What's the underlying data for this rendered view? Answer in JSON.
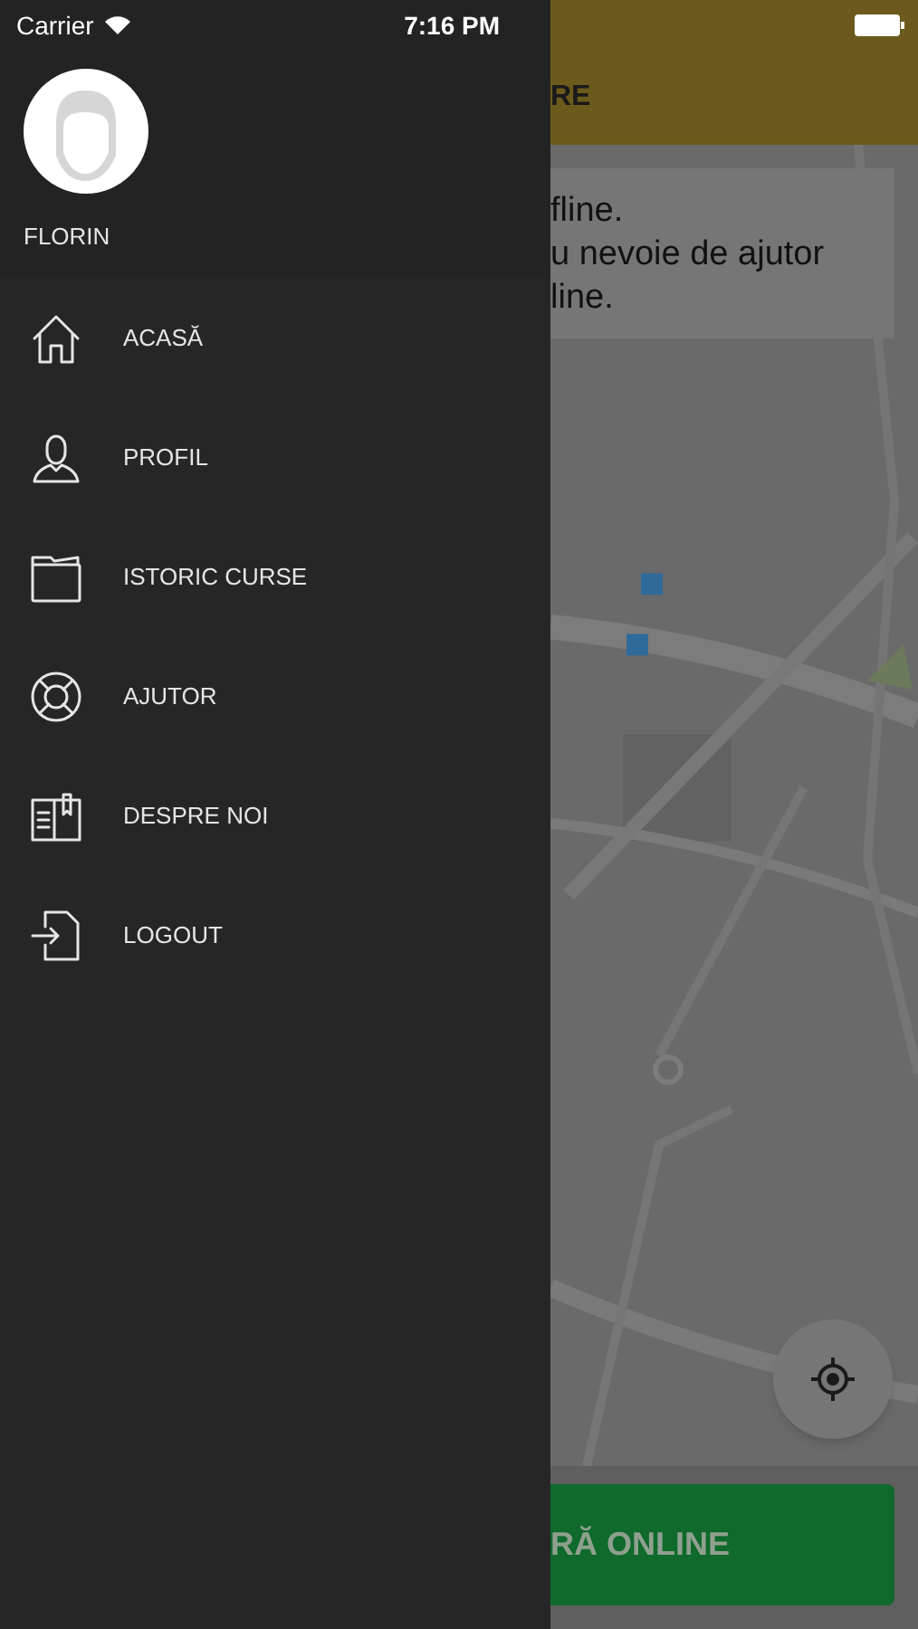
{
  "status_bar": {
    "carrier": "Carrier",
    "time": "7:16 PM"
  },
  "drawer": {
    "user_name": "FLORIN",
    "menu": [
      {
        "label": "ACASĂ"
      },
      {
        "label": "PROFIL"
      },
      {
        "label": "ISTORIC CURSE"
      },
      {
        "label": "AJUTOR"
      },
      {
        "label": "DESPRE NOI"
      },
      {
        "label": "LOGOUT"
      }
    ]
  },
  "main": {
    "header_title": "RE",
    "notice_lines": [
      "fline.",
      "u nevoie de ajutor",
      "line."
    ],
    "online_button": "RĂ ONLINE"
  }
}
